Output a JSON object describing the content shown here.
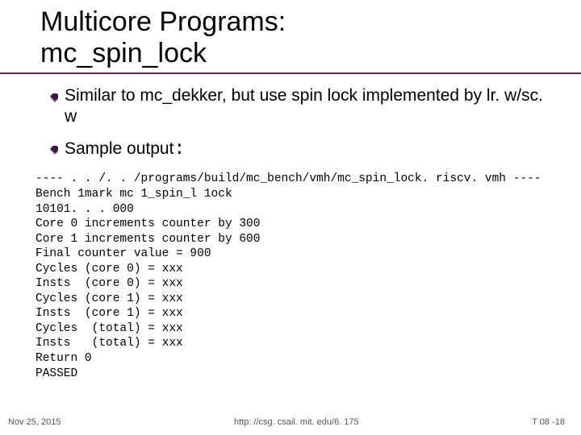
{
  "title_line1": "Multicore Programs:",
  "title_line2": "mc_spin_lock",
  "bullets": [
    "Similar to mc_dekker, but use spin lock implemented by lr. w/sc. w",
    "Sample output"
  ],
  "code": "---- . . /. . /programs/build/mc_bench/vmh/mc_spin_lock. riscv. vmh ----\nBench 1mark mc 1_spin_l 1ock\n10101. . . 000\nCore 0 increments counter by 300\nCore 1 increments counter by 600\nFinal counter value = 900\nCycles (core 0) = xxx\nInsts  (core 0) = xxx\nCycles (core 1) = xxx\nInsts  (core 1) = xxx\nCycles  (total) = xxx\nInsts   (total) = xxx\nReturn 0\nPASSED",
  "footer": {
    "date": "Nov 25, 2015",
    "url": "http: //csg. csail. mit. edu/6. 175",
    "page": "T 08 -18"
  },
  "colors": {
    "accent": "#5c2a5c",
    "bullet_dark": "#3a1a3a",
    "bullet_light": "#b98cb9"
  }
}
